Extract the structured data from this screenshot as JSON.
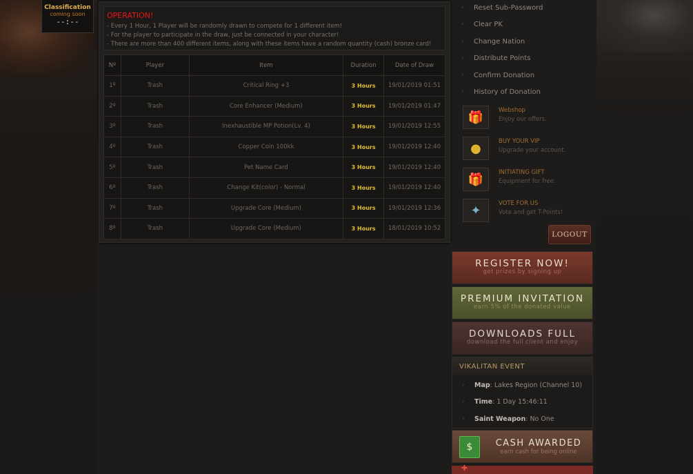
{
  "classification": {
    "dots": "·····",
    "title": "Classification",
    "status": "coming soon",
    "timer": "--:--"
  },
  "notice": {
    "heading": "OPERATION!",
    "lines": [
      "- Every 1 Hour, 1 Player will be randomly drawn to compete for 1 different item!",
      "- For the player to participate in the draw, just be connected in your character!",
      "- There are more than 400 different items, along with these items have a random quantity (cash) bronze card!"
    ]
  },
  "table": {
    "headers": [
      "Nº",
      "Player",
      "Item",
      "Duration",
      "Date of Draw"
    ],
    "rows": [
      {
        "n": "1º",
        "player": "Trash",
        "item": "Critical Ring +3",
        "duration": "3 Hours",
        "date": "19/01/2019 01:51"
      },
      {
        "n": "2º",
        "player": "Trash",
        "item": "Core Enhancer (Medium)",
        "duration": "3 Hours",
        "date": "19/01/2019 01:47"
      },
      {
        "n": "3º",
        "player": "Trash",
        "item": "Inexhaustible MP Potion(Lv. 4)",
        "duration": "3 Hours",
        "date": "19/01/2019 12:55"
      },
      {
        "n": "4º",
        "player": "Trash",
        "item": "Copper Coin 100kk",
        "duration": "3 Hours",
        "date": "19/01/2019 12:40"
      },
      {
        "n": "5º",
        "player": "Trash",
        "item": "Pet Name Card",
        "duration": "3 Hours",
        "date": "19/01/2019 12:40"
      },
      {
        "n": "6º",
        "player": "Trash",
        "item": "Change Kit(color) - Normal",
        "duration": "3 Hours",
        "date": "19/01/2019 12:40"
      },
      {
        "n": "7º",
        "player": "Trash",
        "item": "Upgrade Core (Medium)",
        "duration": "3 Hours",
        "date": "19/01/2019 12:36"
      },
      {
        "n": "8º",
        "player": "Trash",
        "item": "Upgrade Core (Medium)",
        "duration": "3 Hours",
        "date": "18/01/2019 10:52"
      }
    ]
  },
  "sidebar": {
    "links": [
      "Reset Sub-Password",
      "Clear PK",
      "Change Nation",
      "Distribute Points",
      "Confirm Donation",
      "History of Donation"
    ],
    "promos": [
      {
        "title": "Webshop",
        "subtitle": "Enjoy our offers.",
        "icon": "gift-box-icon"
      },
      {
        "title": "BUY YOUR VIP",
        "subtitle": "Upgrade your account.",
        "icon": "gold-coins-icon"
      },
      {
        "title": "INITIATING GIFT",
        "subtitle": "Equipment for free.",
        "icon": "gift-box-icon"
      },
      {
        "title": "VOTE FOR US",
        "subtitle": "Vote and get T-Points!",
        "icon": "vote-icon"
      }
    ],
    "logout": "LOGOUT"
  },
  "banners": [
    {
      "title": "REGISTER NOW!",
      "subtitle": "get prizes by signing up",
      "color": "#6e3024"
    },
    {
      "title": "PREMIUM INVITATION",
      "subtitle": "earn 5% of the donated value",
      "color": "#5a6030"
    },
    {
      "title": "DOWNLOADS FULL",
      "subtitle": "download the full client and enjoy",
      "color": "#4a3030"
    }
  ],
  "event": {
    "heading": "VIKALITAN EVENT",
    "map_label": "Map",
    "map_value": ": Lakes Region (Channel 10)",
    "time_label": "Time",
    "time_value": ": 1 Day 15:46:11",
    "weapon_label": "Saint Weapon",
    "weapon_value": ": No One"
  },
  "cash": {
    "title": "CASH AWARDED",
    "subtitle": "earn cash for being online",
    "icon": "money-stack-icon"
  },
  "colors": {
    "accent_red": "#e81818",
    "duration_yellow": "#e0c030",
    "promo_orange": "#a06e32"
  }
}
